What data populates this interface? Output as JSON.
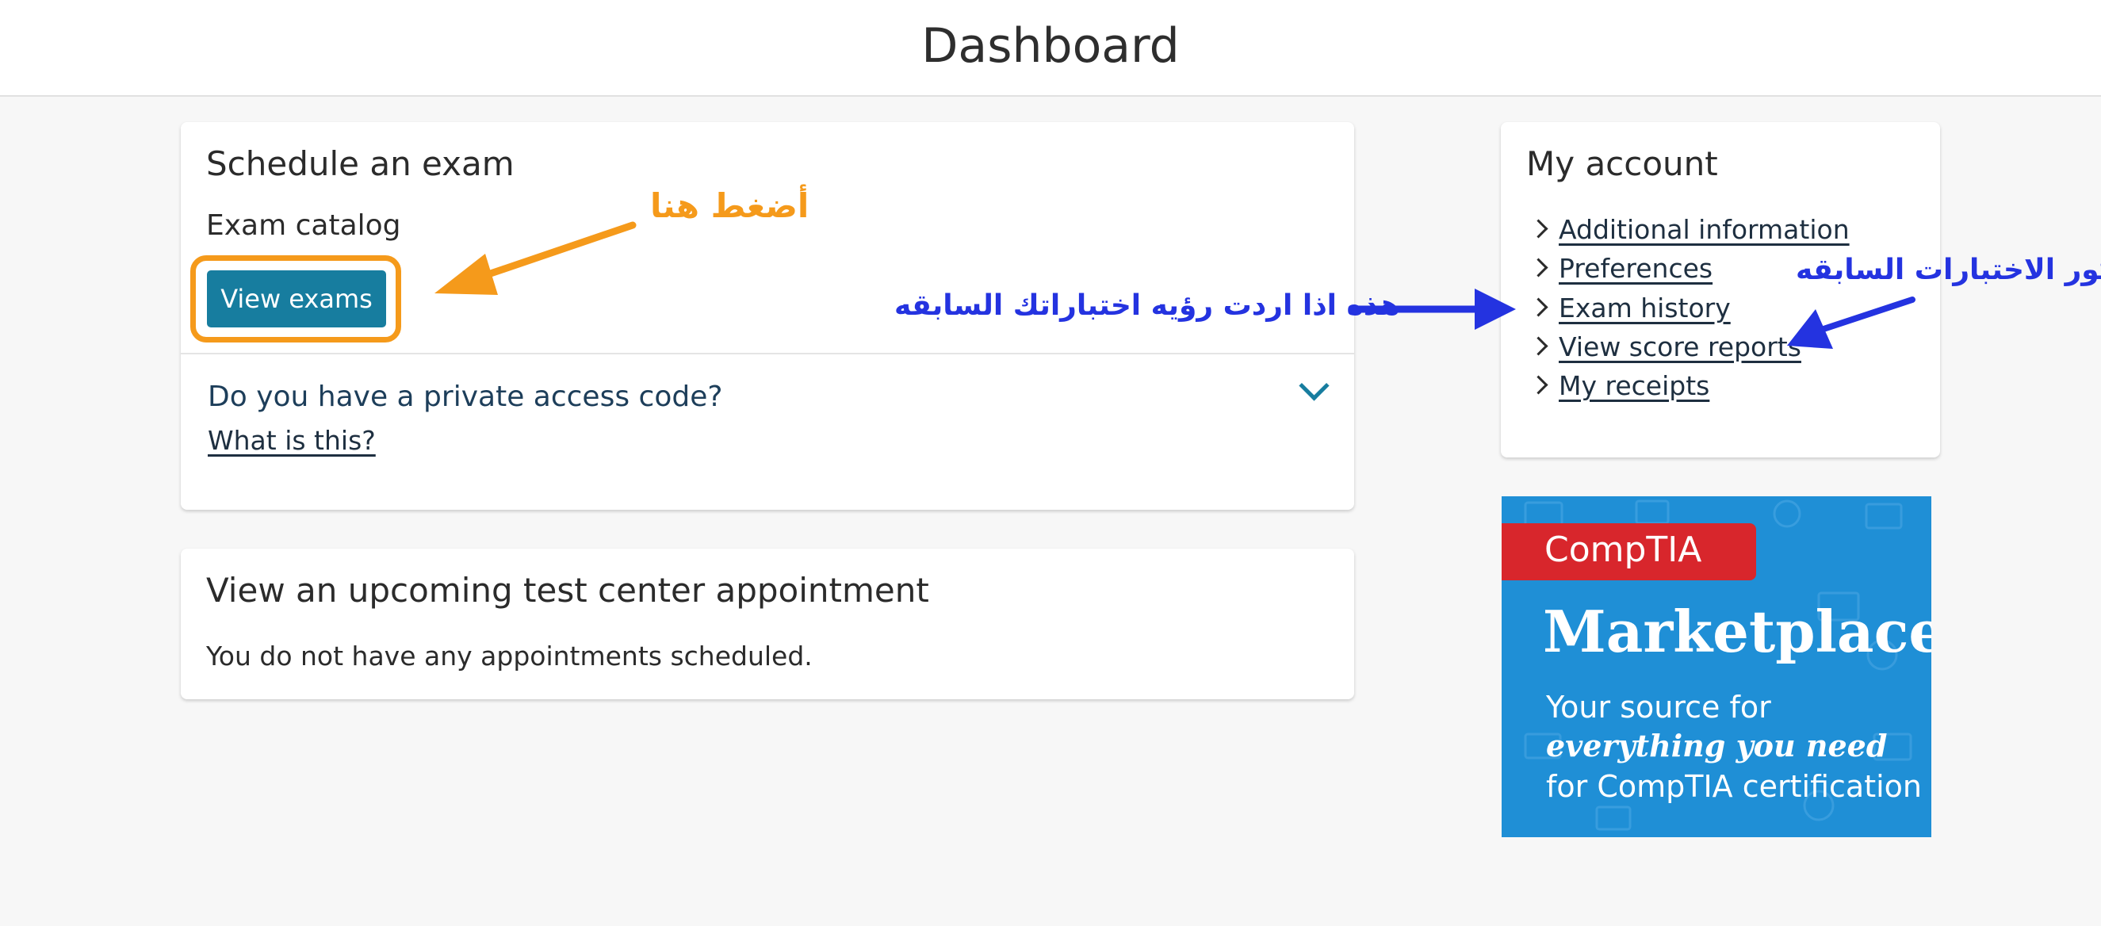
{
  "header": {
    "title": "Dashboard"
  },
  "schedule_card": {
    "title": "Schedule an exam",
    "catalog_label": "Exam catalog",
    "view_exams_button": "View exams",
    "access_code_question": "Do you have a private access code?",
    "what_is_this_link": "What is this?"
  },
  "appointment_card": {
    "title": "View an upcoming test center appointment",
    "empty_message": "You do not have any appointments scheduled."
  },
  "account_card": {
    "title": "My account",
    "links": [
      {
        "label": "Additional information"
      },
      {
        "label": "Preferences"
      },
      {
        "label": "Exam history"
      },
      {
        "label": "View score reports"
      },
      {
        "label": "My receipts"
      }
    ]
  },
  "annotations": {
    "click_here": "أضغط هنا",
    "exam_history_note": "هذه اذا اردت رؤيه اختباراتك السابقه",
    "score_reports_note": "سكور الاختبارات السابقه"
  },
  "ad_banner": {
    "brand": "CompTIA",
    "headline": "Marketplace",
    "line1": "Your source for",
    "line2": "everything you need",
    "line3": "for CompTIA certification"
  },
  "colors": {
    "primary_button": "#177d9f",
    "annotation_orange": "#f59a1b",
    "annotation_blue": "#2433e0",
    "ad_background": "#1f8fd6",
    "ad_brand_red": "#d8262c"
  },
  "icons": [
    "chevron-down-icon",
    "chevron-right-icon",
    "arrow-icon"
  ]
}
